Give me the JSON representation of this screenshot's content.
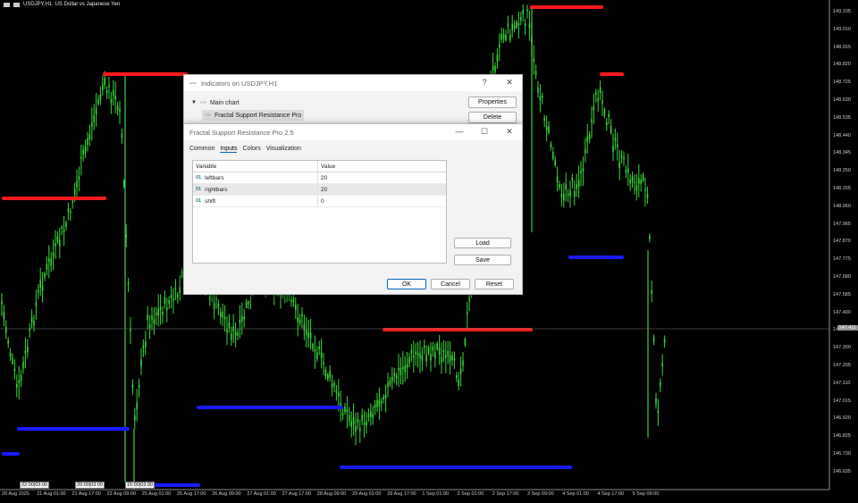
{
  "chart": {
    "symbol_title": "USDJPY,H1: US Dollar vs Japanese Yen",
    "current_price": "147.411",
    "price_ticks": [
      "149.105",
      "149.010",
      "148.915",
      "148.820",
      "148.725",
      "148.630",
      "148.535",
      "148.440",
      "148.345",
      "148.250",
      "148.155",
      "148.060",
      "147.965",
      "147.870",
      "147.775",
      "147.680",
      "147.585",
      "147.490",
      "147.395",
      "147.300",
      "147.205",
      "147.110",
      "147.015",
      "146.920",
      "146.825",
      "146.730",
      "146.635"
    ],
    "time_ticks": [
      "20 Aug 2025",
      "21 Aug 01:00",
      "21 Aug 17:00",
      "22 Aug 09:00",
      "25 Aug 01:00",
      "25 Aug 17:00",
      "26 Aug 09:00",
      "27 Aug 01:00",
      "27 Aug 17:00",
      "28 Aug 09:00",
      "29 Aug 01:00",
      "29 Aug 17:00",
      "1 Sep 01:00",
      "2 Sep 01:00",
      "2 Sep 17:00",
      "3 Sep 09:00",
      "4 Sep 01:00",
      "4 Sep 17:00",
      "5 Sep 09:00"
    ],
    "time_labels": [
      "22:00|03:00",
      "20:00|03:00",
      "15:00|03:00"
    ],
    "colors": {
      "resistance": "#ff1a1a",
      "support": "#1a1aff",
      "candles": "#39d639",
      "background": "#000000"
    }
  },
  "indicators_dialog": {
    "title": "Indicators on USDJPY,H1",
    "help_label": "?",
    "close_label": "✕",
    "tree": {
      "root": "Main chart",
      "child": "Fractal Support Resistance Pro"
    },
    "properties_label": "Properties",
    "delete_label": "Delete"
  },
  "props_dialog": {
    "title": "Fractal Support Resistance Pro 2.5",
    "minimize_label": "—",
    "maximize_label": "☐",
    "close_label": "✕",
    "tabs": [
      "Common",
      "Inputs",
      "Colors",
      "Visualization"
    ],
    "active_tab": "Inputs",
    "table": {
      "headers": [
        "Variable",
        "Value"
      ],
      "rows": [
        {
          "icon": "01",
          "name": "leftbars",
          "value": "20"
        },
        {
          "icon": "01",
          "name": "rightbars",
          "value": "20"
        },
        {
          "icon": "01",
          "name": "shift",
          "value": "0"
        }
      ]
    },
    "load_label": "Load",
    "save_label": "Save",
    "ok_label": "OK",
    "cancel_label": "Cancel",
    "reset_label": "Reset"
  }
}
